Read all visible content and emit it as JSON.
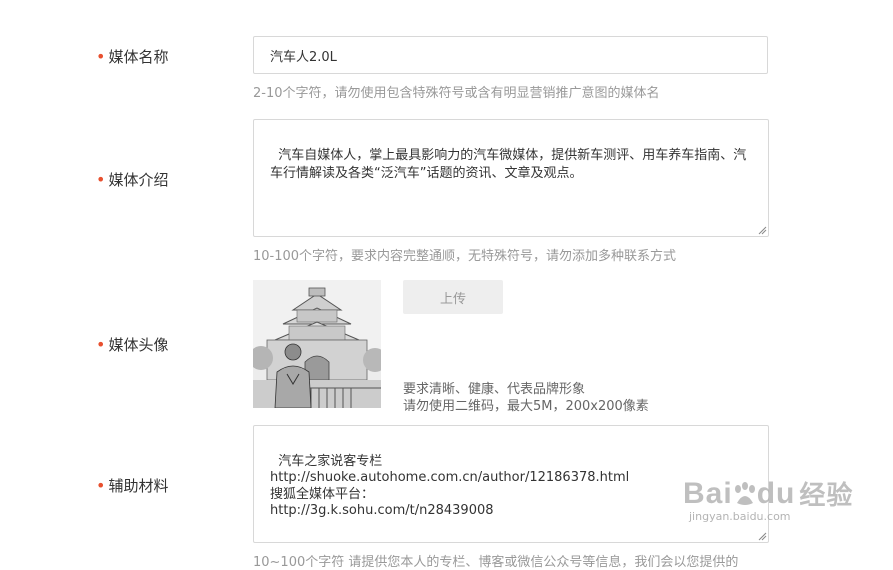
{
  "fields": {
    "name": {
      "label": "媒体名称",
      "value": "汽车人2.0L",
      "hint": "2-10个字符，请勿使用包含特殊符号或含有明显营销推广意图的媒体名"
    },
    "intro": {
      "label": "媒体介绍",
      "value": "汽车自媒体人，掌上最具影响力的汽车微媒体，提供新车测评、用车养车指南、汽车行情解读及各类“泛汽车”话题的资讯、文章及观点。",
      "hint": "10-100个字符，要求内容完整通顺，无特殊符号，请勿添加多种联系方式"
    },
    "avatar": {
      "label": "媒体头像",
      "upload_label": "上传",
      "hint_line1": "要求清晰、健康、代表品牌形象",
      "hint_line2": "请勿使用二维码，最大5M，200x200像素"
    },
    "aux": {
      "label": "辅助材料",
      "value": "汽车之家说客专栏\nhttp://shuoke.autohome.com.cn/author/12186378.html\n搜狐全媒体平台：\nhttp://3g.k.sohu.com/t/n28439008",
      "hint": "10~100个字符 请提供您本人的专栏、博客或微信公众号等信息，我们会以您提供的"
    }
  },
  "watermark": {
    "brand": "Bai",
    "brand2": "du",
    "cn": "经验",
    "url": "jingyan.baidu.com"
  },
  "colors": {
    "required_dot": "#e8502f",
    "hint": "#999999",
    "border": "#d8d8d8"
  }
}
